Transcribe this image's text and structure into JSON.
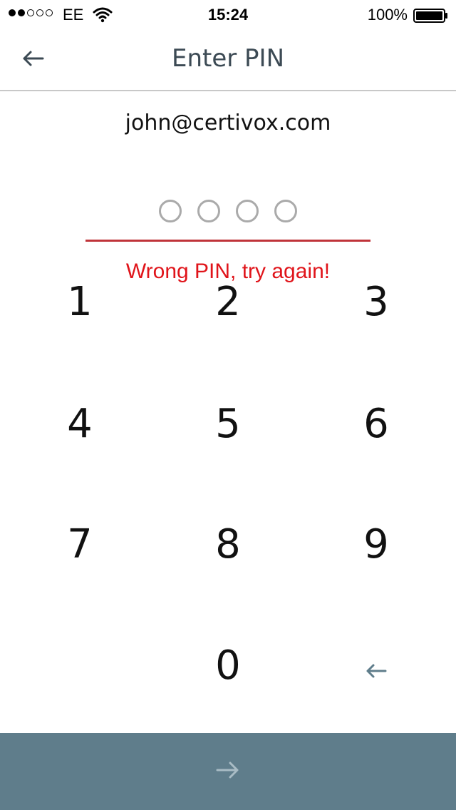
{
  "status_bar": {
    "carrier": "EE",
    "time": "15:24",
    "battery": "100%"
  },
  "nav": {
    "title": "Enter PIN",
    "back_icon": "arrow-left-icon"
  },
  "account": {
    "email": "john@certivox.com"
  },
  "pin": {
    "length": 4,
    "entered": 0,
    "error": "Wrong PIN, try again!",
    "underline_color": "#c0343a",
    "error_color": "#e0141a"
  },
  "keypad": {
    "k1": "1",
    "k2": "2",
    "k3": "3",
    "k4": "4",
    "k5": "5",
    "k6": "6",
    "k7": "7",
    "k8": "8",
    "k9": "9",
    "k0": "0",
    "delete_icon": "backspace-arrow-icon"
  },
  "submit": {
    "icon": "arrow-right-icon",
    "background": "#5f7d8b"
  }
}
